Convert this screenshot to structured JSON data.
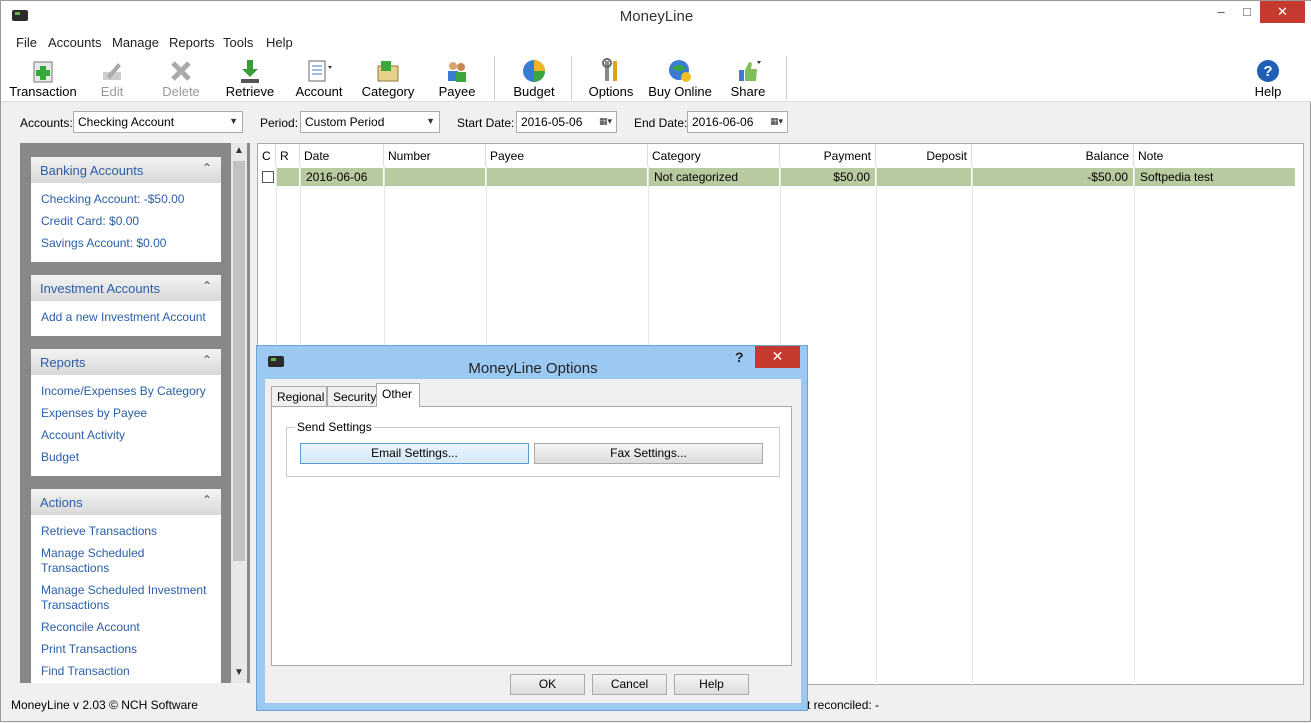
{
  "window": {
    "title": "MoneyLine",
    "minimize": "–",
    "maximize": "□",
    "close": "✕"
  },
  "menu": [
    "File",
    "Accounts",
    "Manage",
    "Reports",
    "Tools",
    "Help"
  ],
  "toolbar": {
    "transaction": "Transaction",
    "edit": "Edit",
    "delete": "Delete",
    "retrieve": "Retrieve",
    "account": "Account",
    "category": "Category",
    "payee": "Payee",
    "budget": "Budget",
    "options": "Options",
    "buy_online": "Buy Online",
    "share": "Share",
    "help": "Help"
  },
  "filters": {
    "accounts_label": "Accounts:",
    "accounts_value": "Checking Account",
    "period_label": "Period:",
    "period_value": "Custom Period",
    "start_label": "Start Date:",
    "start_value": "2016-05-06",
    "end_label": "End Date:",
    "end_value": "2016-06-06"
  },
  "sidebar": {
    "banking": {
      "title": "Banking Accounts",
      "items": [
        "Checking Account: -$50.00",
        "Credit Card: $0.00",
        "Savings Account: $0.00"
      ]
    },
    "investment": {
      "title": "Investment Accounts",
      "items": [
        "Add a new Investment Account"
      ]
    },
    "reports": {
      "title": "Reports",
      "items": [
        "Income/Expenses By Category",
        "Expenses by Payee",
        "Account Activity",
        "Budget"
      ]
    },
    "actions": {
      "title": "Actions",
      "items": [
        "Retrieve Transactions",
        "Manage Scheduled Transactions",
        "Manage Scheduled Investment Transactions",
        "Reconcile Account",
        "Print Transactions",
        "Find Transaction"
      ]
    }
  },
  "grid": {
    "headers": [
      "C",
      "R",
      "Date",
      "Number",
      "Payee",
      "Category",
      "Payment",
      "Deposit",
      "Balance",
      "Note"
    ],
    "rows": [
      {
        "date": "2016-06-06",
        "number": "",
        "payee": "",
        "category": "Not categorized",
        "payment": "$50.00",
        "deposit": "",
        "balance": "-$50.00",
        "note": "Softpedia test"
      }
    ]
  },
  "status": {
    "left": "MoneyLine v 2.03 © NCH Software",
    "right": "t reconciled: -"
  },
  "dialog": {
    "title": "MoneyLine Options",
    "help_glyph": "?",
    "close": "✕",
    "tabs": [
      "Regional",
      "Security",
      "Other"
    ],
    "group": "Send Settings",
    "email_button": "Email Settings...",
    "fax_button": "Fax Settings...",
    "ok": "OK",
    "cancel": "Cancel",
    "help": "Help"
  }
}
